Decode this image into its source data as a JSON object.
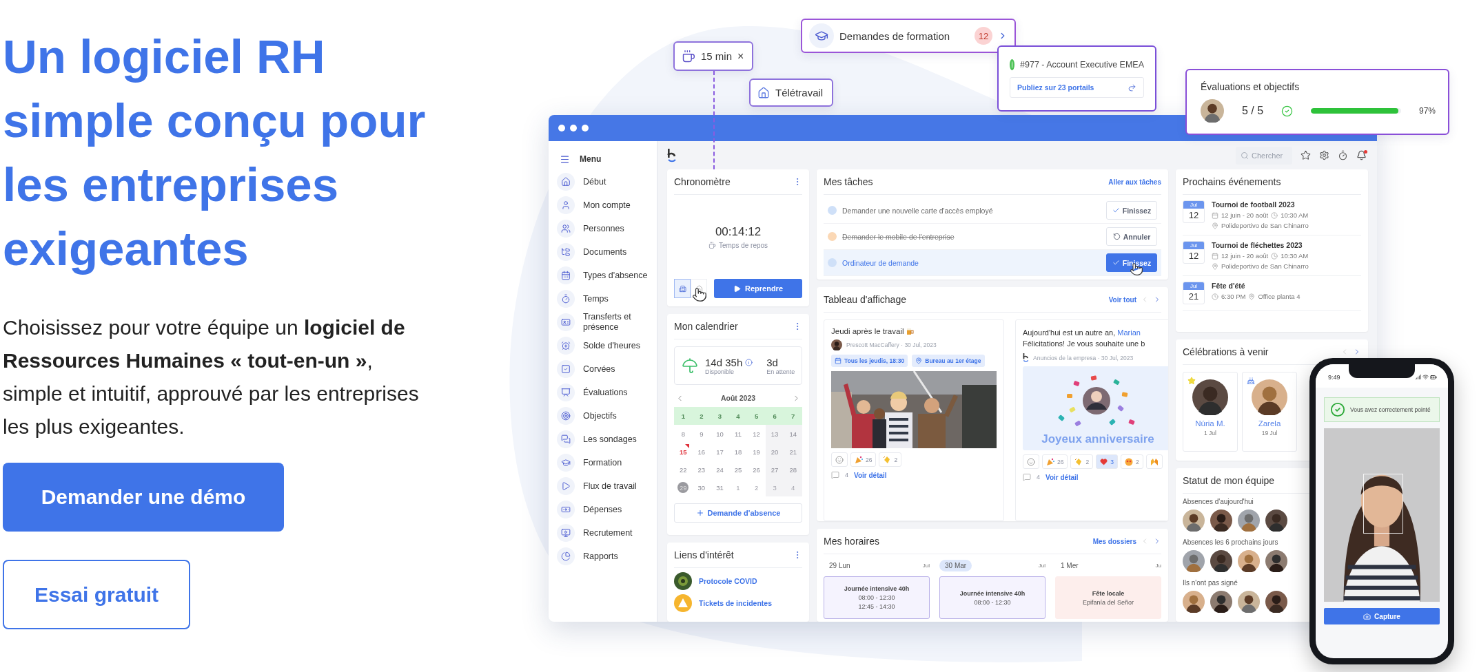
{
  "hero": {
    "title": "Un logiciel RH simple conçu pour les entreprises exigeantes",
    "description": "Choisissez pour votre équipe un **logiciel de Ressources Humaines « tout-en-un »**, simple et intuitif, approuvé par les entreprises les plus exigeantes.",
    "buttons": [
      {
        "label": "Demander une démo",
        "kind": "primary"
      },
      {
        "label": "Essai gratuit",
        "kind": "secondary"
      }
    ]
  },
  "floating": {
    "break_chip": {
      "label": "15 min",
      "close": "×"
    },
    "remote_chip": {
      "label": "Télétravail"
    },
    "training": {
      "label": "Demandes de formation",
      "count": "12"
    },
    "job": {
      "title": "#977 - Account Executive EMEA",
      "action": "Publiez sur 23 portails"
    },
    "reviews": {
      "title": "Évaluations et objectifs",
      "score": "5 / 5",
      "level": 0.97,
      "percent": "97%"
    }
  },
  "sidebar": {
    "title": "Menu",
    "items": [
      "Début",
      "Mon compte",
      "Personnes",
      "Documents",
      "Types d'absence",
      "Temps",
      "Transferts et présence",
      "Solde d'heures",
      "Corvées",
      "Évaluations",
      "Objectifs",
      "Les sondages",
      "Formation",
      "Flux de travail",
      "Dépenses",
      "Recrutement",
      "Rapports"
    ]
  },
  "topbar": {
    "search_placeholder": "Chercher"
  },
  "stopwatch": {
    "title": "Chronomètre",
    "time": "00:14:12",
    "status": "Temps de repos",
    "action": "Reprendre",
    "modes": [
      {
        "selected": true
      },
      {
        "selected": false
      }
    ]
  },
  "calendar": {
    "title": "Mon calendrier",
    "available": "14d 35h",
    "available_label": "Disponible",
    "pending": "3d",
    "pending_label": "En attente",
    "month": "Août 2023",
    "request": "Demande d'absence",
    "weeks": [
      [
        {
          "day": "1",
          "kind": "range"
        },
        {
          "day": "2",
          "kind": "range"
        },
        {
          "day": "3",
          "kind": "range"
        },
        {
          "day": "4",
          "kind": "range"
        },
        {
          "day": "5",
          "kind": "range"
        },
        {
          "day": "6",
          "kind": "range"
        },
        {
          "day": "7",
          "kind": "range"
        }
      ],
      [
        {
          "day": "8",
          "kind": "normal"
        },
        {
          "day": "9",
          "kind": "normal"
        },
        {
          "day": "10",
          "kind": "normal"
        },
        {
          "day": "11",
          "kind": "normal"
        },
        {
          "day": "12",
          "kind": "normal"
        },
        {
          "day": "13",
          "kind": "normal"
        },
        {
          "day": "14",
          "kind": "normal"
        }
      ],
      [
        {
          "day": "15",
          "kind": "today"
        },
        {
          "day": "16",
          "kind": "normal"
        },
        {
          "day": "17",
          "kind": "normal"
        },
        {
          "day": "18",
          "kind": "normal"
        },
        {
          "day": "19",
          "kind": "normal"
        },
        {
          "day": "20",
          "kind": "normal"
        },
        {
          "day": "21",
          "kind": "normal"
        }
      ],
      [
        {
          "day": "22",
          "kind": "normal"
        },
        {
          "day": "23",
          "kind": "normal"
        },
        {
          "day": "24",
          "kind": "normal"
        },
        {
          "day": "25",
          "kind": "normal"
        },
        {
          "day": "26",
          "kind": "normal"
        },
        {
          "day": "27",
          "kind": "normal"
        },
        {
          "day": "28",
          "kind": "normal"
        }
      ],
      [
        {
          "day": "29",
          "kind": "marked"
        },
        {
          "day": "30",
          "kind": "normal"
        },
        {
          "day": "31",
          "kind": "normal"
        },
        {
          "day": "1",
          "kind": "other"
        },
        {
          "day": "2",
          "kind": "other"
        },
        {
          "day": "3",
          "kind": "other"
        },
        {
          "day": "4",
          "kind": "other"
        }
      ]
    ]
  },
  "links": {
    "title": "Liens d'intérêt",
    "items": [
      {
        "kind": "virus",
        "label": "Protocole COVID"
      },
      {
        "kind": "warning",
        "label": "Tickets de incidentes"
      }
    ]
  },
  "tasks": {
    "title": "Mes tâches",
    "link": "Aller aux tâches",
    "items": [
      {
        "text": "Demander une nouvelle carte d'accès employé",
        "color": "#cfe0f8",
        "done": false,
        "highlighted": false,
        "action": "Finissez"
      },
      {
        "text": "Demander le mobile de l'entreprise",
        "color": "#fbd8b5",
        "done": true,
        "highlighted": false,
        "action": "Annuler"
      },
      {
        "text": "Ordinateur de demande",
        "color": "#cfe0f8",
        "done": false,
        "highlighted": true,
        "action": "Finissez"
      }
    ]
  },
  "board": {
    "title": "Tableau d'affichage",
    "link": "Voir tout",
    "posts": [
      {
        "title": "Jeudi après le travail",
        "meta": "Prescott MacCaffery · 30 Jul, 2023",
        "tags": [
          {
            "kind": "date",
            "label": "Tous les jeudis, 18:30"
          },
          {
            "kind": "place",
            "label": "Bureau au 1er étage"
          }
        ],
        "reactions": [
          {
            "kind": "party",
            "count": "26",
            "selected": false
          },
          {
            "kind": "clap",
            "count": "2",
            "selected": false
          }
        ],
        "comments": "4",
        "detail": "Voir détail"
      },
      {
        "kind": "birthday",
        "text": "Aujourd'hui est un autre an,",
        "mention": "Marian",
        "text2": "Félicitations! Je vous souhaite une b",
        "meta": "Anuncios de la empresa · 30 Jul, 2023",
        "banner": "Joyeux anniversaire",
        "reactions": [
          {
            "kind": "party",
            "count": "26",
            "selected": false
          },
          {
            "kind": "clap",
            "count": "2",
            "selected": false
          },
          {
            "kind": "heart",
            "count": "3",
            "selected": true
          },
          {
            "kind": "love",
            "count": "2",
            "selected": false
          },
          {
            "kind": "hands",
            "selected": false
          }
        ],
        "comments": "4",
        "detail": "Voir détail"
      }
    ]
  },
  "schedule": {
    "title": "Mes horaires",
    "link": "Mes dossiers",
    "days": [
      {
        "label": "29 Lun",
        "month": "Jul",
        "selected": false,
        "shift": {
          "kind": "work",
          "title": "Journée intensive  40h",
          "times": [
            "08:00 - 12:30",
            "12:45 - 14:30"
          ]
        }
      },
      {
        "label": "30 Mar",
        "month": "Jul",
        "selected": true,
        "shift": {
          "kind": "work",
          "title": "Journée intensive  40h",
          "times": [
            "08:00 - 12:30"
          ]
        }
      },
      {
        "label": "1 Mer",
        "month": "Ju",
        "selected": false,
        "shift": {
          "kind": "holiday",
          "title": "Fête locale",
          "times": [
            "Epifanía del Señor"
          ]
        }
      }
    ]
  },
  "events": {
    "title": "Prochains événements",
    "items": [
      {
        "month": "Jul",
        "day": "12",
        "title": "Tournoi de football 2023",
        "dates": "12 juin - 20 août",
        "time": "10:30 AM",
        "place": "Polideportivo de San Chinarro"
      },
      {
        "month": "Jul",
        "day": "12",
        "title": "Tournoi de fléchettes 2023",
        "dates": "12 juin - 20 août",
        "time": "10:30 AM",
        "place": "Polideportivo de San Chinarro"
      },
      {
        "month": "Jul",
        "day": "21",
        "title": "Fête d'été",
        "time": "6:30 PM",
        "place": "Office planta 4"
      }
    ]
  },
  "celebrations": {
    "title": "Célébrations à venir",
    "people": [
      {
        "kind": "anniversary",
        "name": "Núria M.",
        "date": "1 Jul"
      },
      {
        "kind": "birthday",
        "name": "Zarela",
        "date": "19 Jul"
      }
    ]
  },
  "team": {
    "title": "Statut de mon équipe",
    "groups": [
      "Absences d'aujourd'hui",
      "Absences les 6 prochains jours",
      "Ils n'ont pas signé"
    ]
  },
  "phone": {
    "time": "9:49",
    "message": "Vous avez correctement pointé",
    "action": "Capture"
  }
}
